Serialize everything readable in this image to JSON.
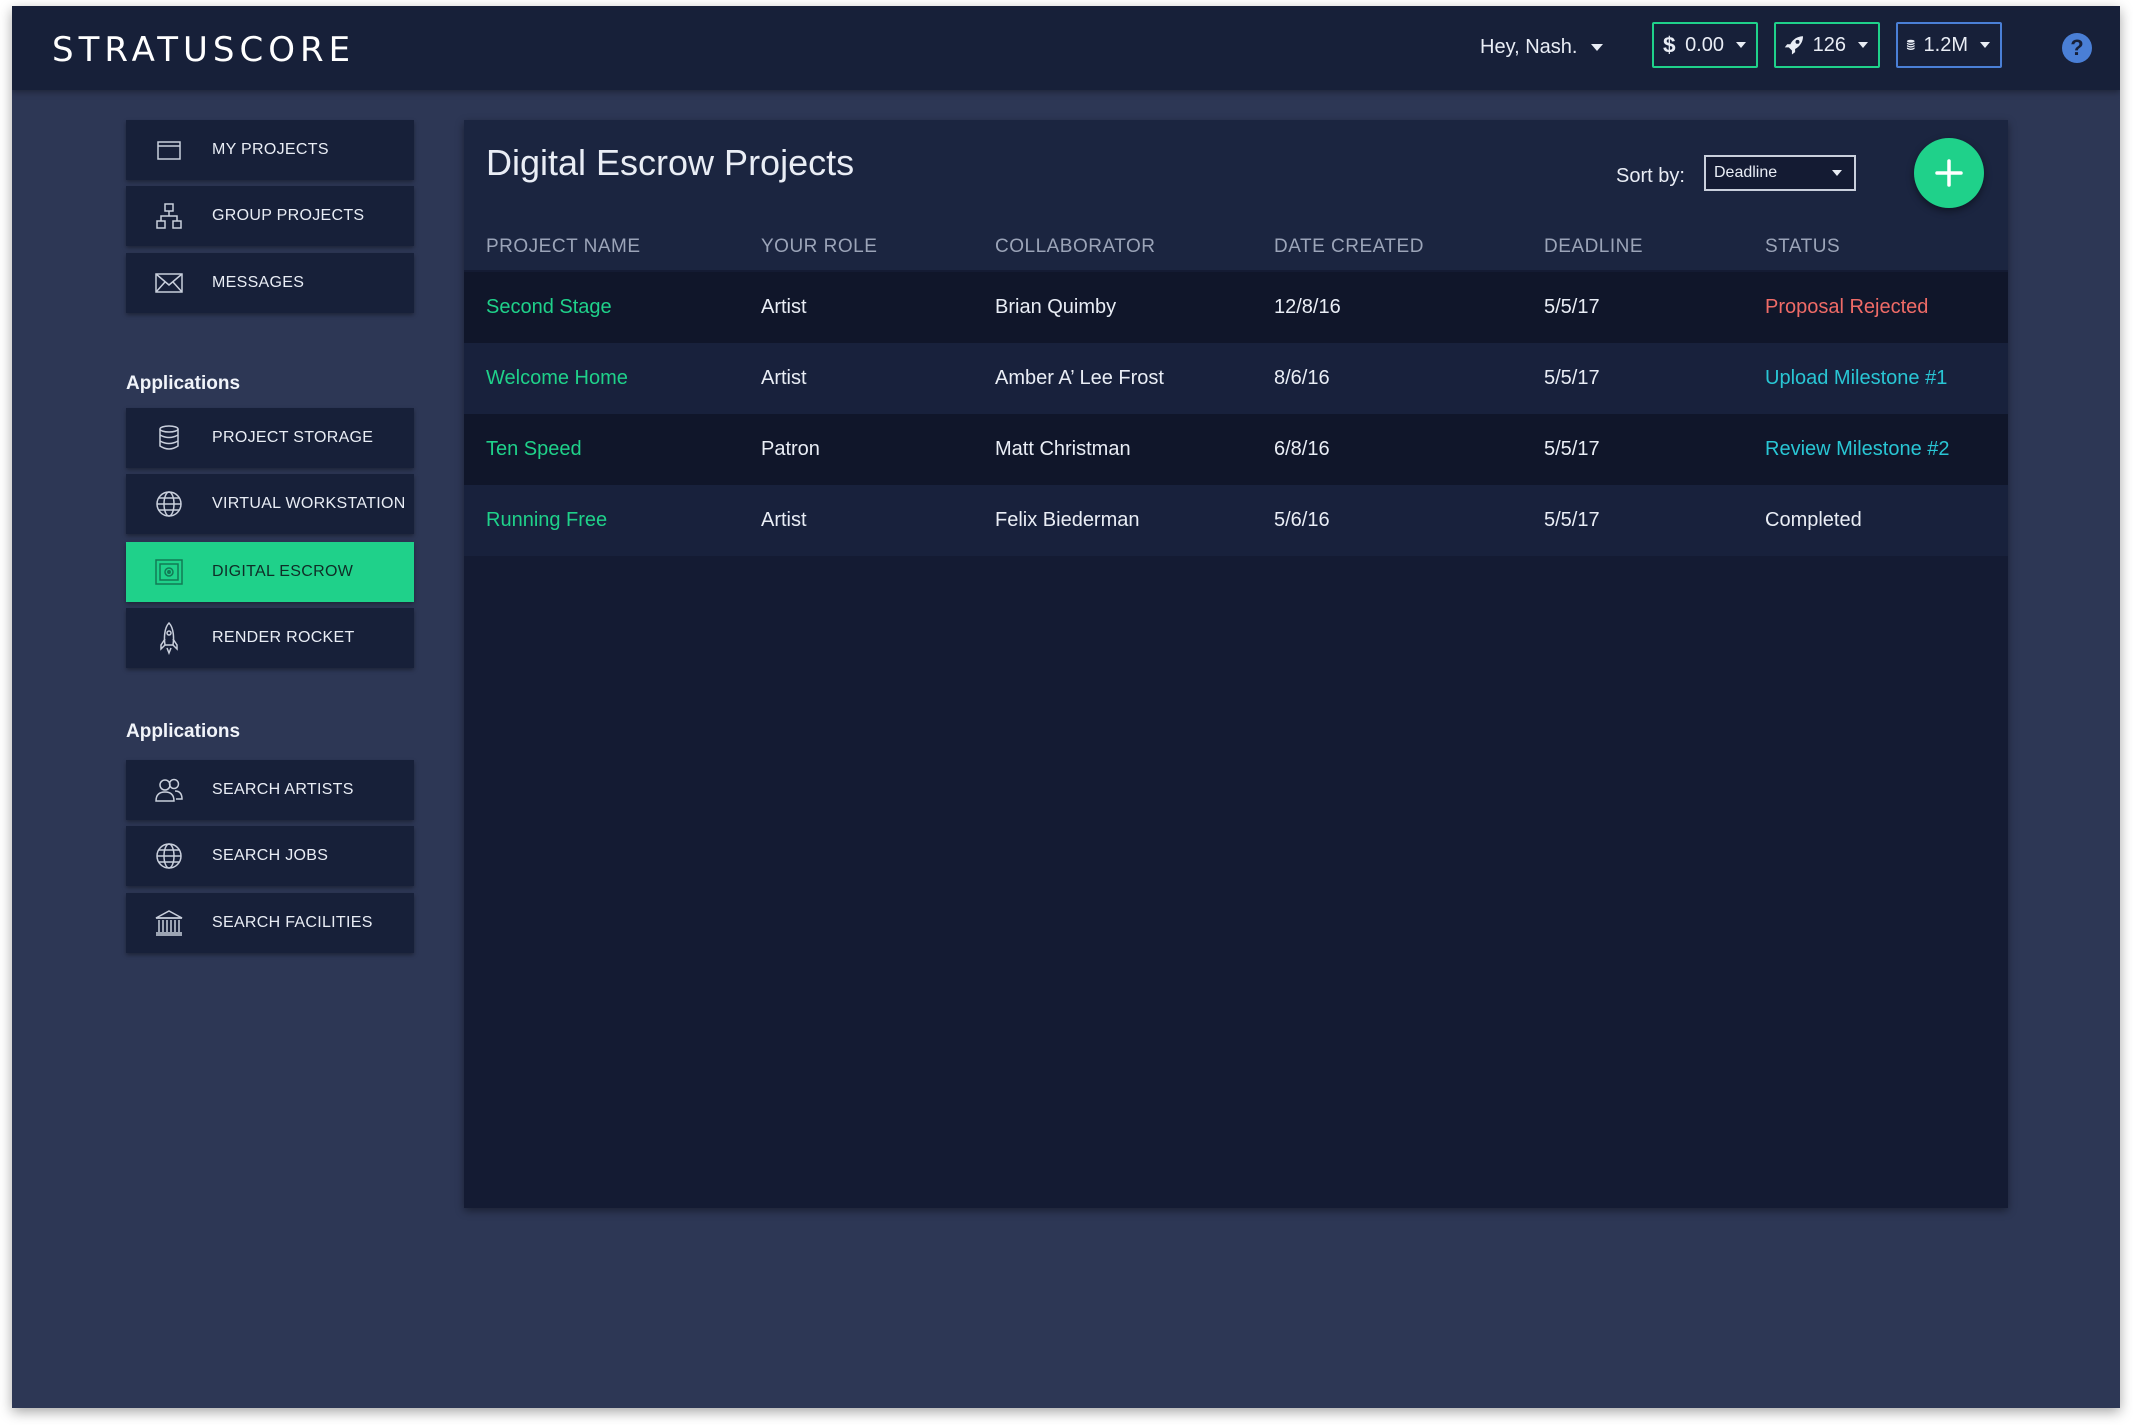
{
  "app": {
    "logo_text": "STRATUSCORE"
  },
  "header": {
    "greeting": "Hey, Nash.",
    "balance": {
      "value": "0.00",
      "icon": "dollar-icon",
      "color": "#1fd18a"
    },
    "rockets": {
      "value": "126",
      "icon": "rocket-icon",
      "color": "#1fd18a"
    },
    "storage": {
      "value": "1.2M",
      "icon": "database-icon",
      "color": "#4a7fd6"
    },
    "help": {
      "label": "?",
      "icon": "help-icon"
    }
  },
  "sidebar": {
    "main_items": [
      {
        "label": "MY PROJECTS",
        "icon": "folder-icon"
      },
      {
        "label": "GROUP PROJECTS",
        "icon": "hierarchy-icon"
      },
      {
        "label": "MESSAGES",
        "icon": "envelope-icon"
      }
    ],
    "section1_title": "Applications",
    "apps": [
      {
        "label": "PROJECT STORAGE",
        "icon": "database-icon"
      },
      {
        "label": "VIRTUAL WORKSTATION",
        "icon": "globe-icon"
      },
      {
        "label": "DIGITAL ESCROW",
        "icon": "safe-icon",
        "active": true
      },
      {
        "label": "RENDER ROCKET",
        "icon": "rocket-icon"
      }
    ],
    "section2_title": "Applications",
    "search": [
      {
        "label": "SEARCH ARTISTS",
        "icon": "users-icon"
      },
      {
        "label": "SEARCH JOBS",
        "icon": "globe-icon"
      },
      {
        "label": "SEARCH FACILITIES",
        "icon": "building-icon"
      }
    ]
  },
  "main": {
    "title": "Digital Escrow Projects",
    "sort_label": "Sort by:",
    "sort_value": "Deadline",
    "add_button": "+",
    "columns": [
      "PROJECT NAME",
      "YOUR ROLE",
      "COLLABORATOR",
      "DATE CREATED",
      "DEADLINE",
      "STATUS"
    ],
    "rows": [
      {
        "name": "Second Stage",
        "role": "Artist",
        "collaborator": "Brian Quimby",
        "created": "12/8/16",
        "deadline": "5/5/17",
        "status": "Proposal Rejected",
        "status_color": "#ef6b67"
      },
      {
        "name": "Welcome Home",
        "role": "Artist",
        "collaborator": "Amber A’ Lee Frost",
        "created": "8/6/16",
        "deadline": "5/5/17",
        "status": "Upload Milestone #1",
        "status_color": "#29c6d4"
      },
      {
        "name": "Ten Speed",
        "role": "Patron",
        "collaborator": "Matt Christman",
        "created": "6/8/16",
        "deadline": "5/5/17",
        "status": "Review Milestone #2",
        "status_color": "#29c6d4"
      },
      {
        "name": "Running Free",
        "role": "Artist",
        "collaborator": "Felix Biederman",
        "created": "5/6/16",
        "deadline": "5/5/17",
        "status": "Completed",
        "status_color": "#e9edf5"
      }
    ]
  },
  "colors": {
    "accent": "#1fd18a",
    "background": "#2d3755",
    "panel": "#141b33",
    "topbar": "#172039"
  }
}
